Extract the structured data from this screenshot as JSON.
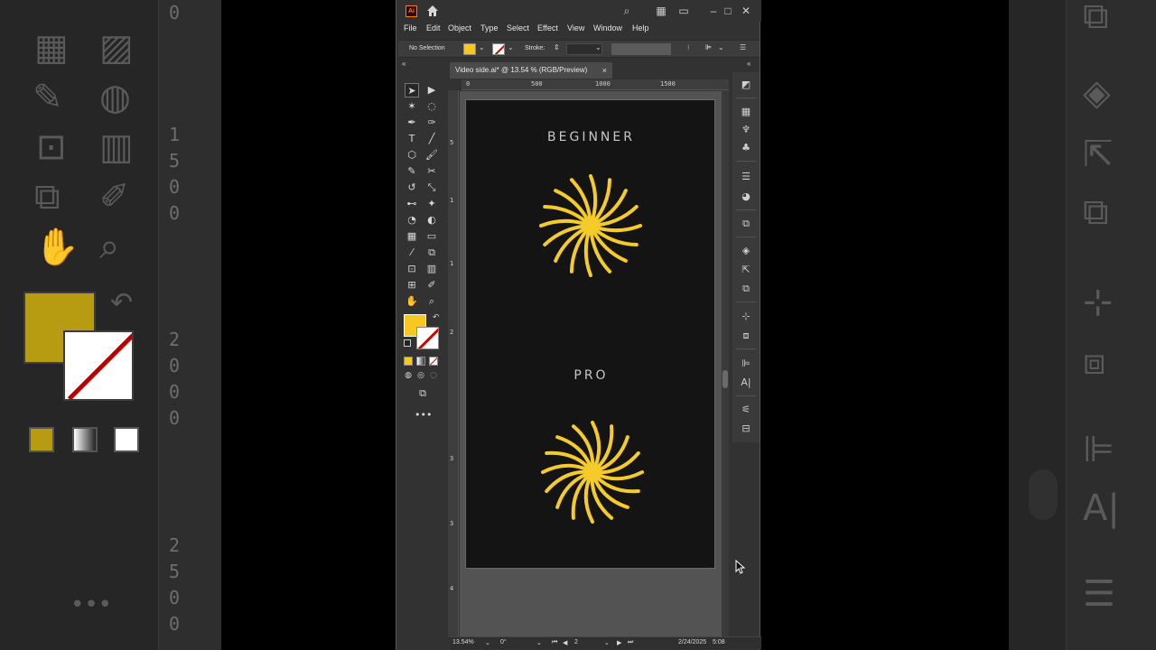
{
  "app": {
    "logo_text": "Ai",
    "menu": [
      "File",
      "Edit",
      "Object",
      "Type",
      "Select",
      "Effect",
      "View",
      "Window",
      "Help"
    ]
  },
  "control_bar": {
    "selection_label": "No Selection",
    "stroke_label": "Stroke:"
  },
  "document_tab": {
    "title": "Video side.ai* @ 13.54 % (RGB/Preview)",
    "close": "×"
  },
  "rulers": {
    "horizontal": [
      "0",
      "500",
      "1000",
      "1500"
    ],
    "vertical": [
      "5",
      "1",
      "1\n5",
      "2",
      "2\n5",
      "3",
      "3\n5",
      "4"
    ]
  },
  "artboard": {
    "label_top": "BEGINNER",
    "label_bottom": "PRO",
    "art_color": "#f5cb2a",
    "background": "#141414"
  },
  "colors": {
    "fill": "#f7c920",
    "stroke": "none"
  },
  "status_bar": {
    "zoom": "13.54%",
    "rotation": "0°",
    "artboard_number": "2",
    "date": "2/24/2025",
    "time": "5:08"
  },
  "side_background": {
    "left_ruler": [
      "0",
      "1",
      "5",
      "0",
      "0",
      "2",
      "0",
      "0",
      "0",
      "2",
      "5",
      "0",
      "0"
    ]
  }
}
